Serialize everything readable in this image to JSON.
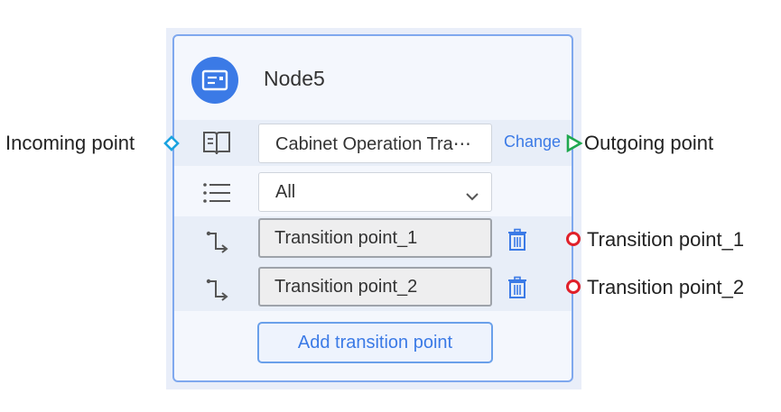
{
  "node": {
    "title": "Node5",
    "icon": "terminal-card-icon"
  },
  "rows": {
    "source": {
      "icon": "book-icon",
      "value": "Cabinet Operation Tra⋯",
      "action_label": "Change"
    },
    "filter": {
      "icon": "list-icon",
      "selected": "All"
    },
    "transitions": [
      {
        "icon": "transition-icon",
        "value": "Transition point_1",
        "delete_icon": "trash-icon"
      },
      {
        "icon": "transition-icon",
        "value": "Transition point_2",
        "delete_icon": "trash-icon"
      }
    ],
    "add_button_label": "Add transition point"
  },
  "annotations": {
    "incoming": "Incoming point",
    "outgoing": "Outgoing point",
    "transition_1": "Transition point_1",
    "transition_2": "Transition point_2"
  },
  "colors": {
    "accent": "#3b7ae6",
    "incoming_marker": "#1aa3e0",
    "outgoing_marker": "#1fa84f",
    "transition_marker": "#e0202a"
  }
}
